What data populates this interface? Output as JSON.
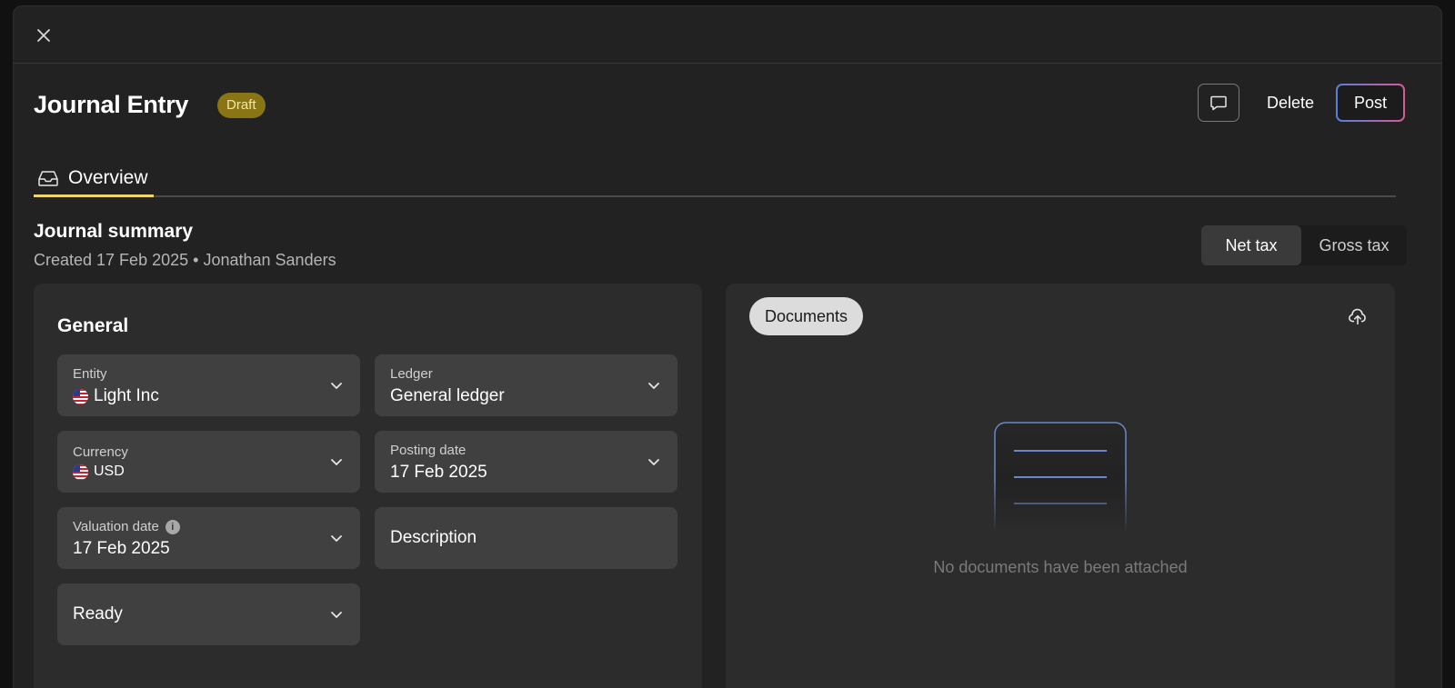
{
  "header": {
    "title": "Journal Entry",
    "status_badge": "Draft",
    "delete_label": "Delete",
    "post_label": "Post"
  },
  "tabs": [
    {
      "label": "Overview",
      "icon": "inbox-icon",
      "active": true
    }
  ],
  "summary": {
    "title": "Journal summary",
    "created_text": "Created 17 Feb 2025",
    "separator": "•",
    "author": "Jonathan Sanders"
  },
  "tax_toggle": {
    "options": [
      "Net tax",
      "Gross tax"
    ],
    "selected": "Net tax"
  },
  "general": {
    "title": "General",
    "fields": {
      "entity": {
        "label": "Entity",
        "value": "Light Inc",
        "flag": "us-flag-icon"
      },
      "ledger": {
        "label": "Ledger",
        "value": "General ledger"
      },
      "currency": {
        "label": "Currency",
        "value": "USD",
        "flag": "us-flag-icon"
      },
      "posting_date": {
        "label": "Posting date",
        "value": "17 Feb 2025"
      },
      "valuation_date": {
        "label": "Valuation date",
        "value": "17 Feb 2025"
      },
      "description": {
        "placeholder": "Description"
      },
      "status": {
        "value": "Ready"
      }
    }
  },
  "documents": {
    "tab_label": "Documents",
    "empty_message": "No documents have been attached"
  },
  "colors": {
    "background": "#222222",
    "panel": "#2c2c2c",
    "field": "#404040",
    "badge": "#8a7514",
    "tab_underline": "#f2d56b",
    "post_gradient_start": "#5a7ddc",
    "post_gradient_end": "#d85a9a"
  }
}
